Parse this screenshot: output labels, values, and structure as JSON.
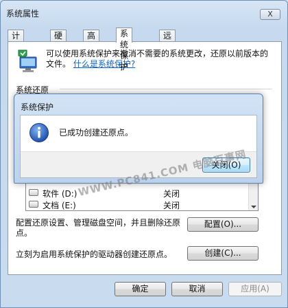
{
  "window": {
    "title": "系统属性",
    "close_label": "X"
  },
  "tabs": [
    {
      "label": "计算机名",
      "active": false
    },
    {
      "label": "硬件",
      "active": false
    },
    {
      "label": "高级",
      "active": false
    },
    {
      "label": "系统保护",
      "active": true
    },
    {
      "label": "远程",
      "active": false
    }
  ],
  "protection": {
    "intro_text": "可以使用系统保护来撤消不需要的系统更改，还原以前版本的文件。",
    "intro_link": "什么是系统保护?",
    "restore_group_label": "系统还原",
    "drives": [
      {
        "name": "软件 (D:)",
        "status": "关闭"
      },
      {
        "name": "文档 (E:)",
        "status": "关闭"
      }
    ],
    "configure_text": "配置还原设置、管理磁盘空间，并且删除还原点。",
    "configure_button": "配置(O)...",
    "create_text": "立刻为启用系统保护的驱动器创建还原点。",
    "create_button": "创建(C)..."
  },
  "buttons": {
    "ok": "确定",
    "cancel": "取消",
    "apply": "应用(A)"
  },
  "dialog": {
    "title": "系统保护",
    "message": "已成功创建还原点。",
    "close_button": "关闭(O)"
  },
  "watermark": "WWW.PC841.COM 电脑百事网",
  "colors": {
    "link": "#0b63c9",
    "info_icon": "#1f62c4"
  }
}
